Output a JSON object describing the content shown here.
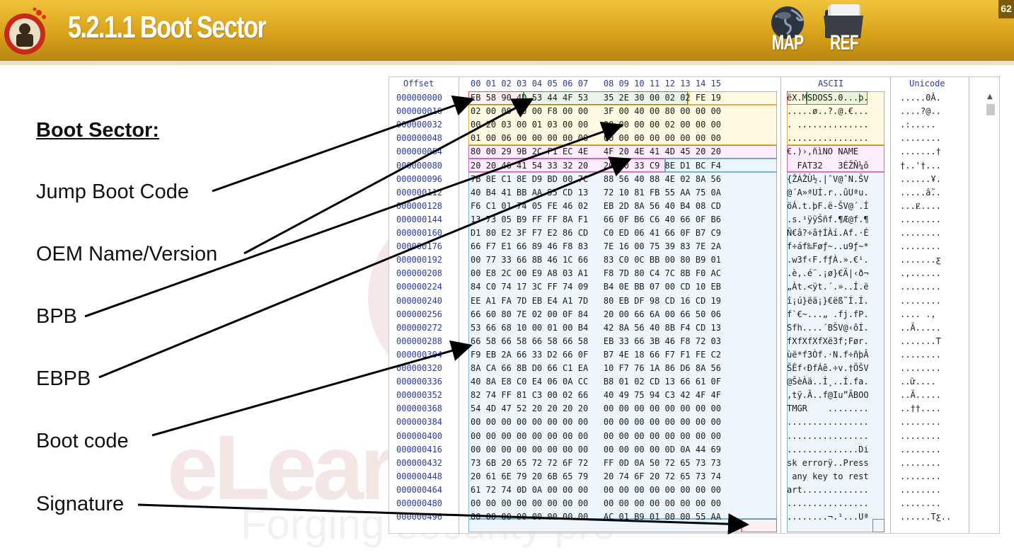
{
  "header": {
    "title": "5.2.1.1 Boot Sector",
    "map_label": "MAP",
    "ref_label": "REF",
    "page_number": "62"
  },
  "watermark": {
    "brand": "eLearn",
    "tagline": "Forging security pro"
  },
  "labels": {
    "section_title": "Boot Sector:",
    "jump": "Jump Boot Code",
    "oem": "OEM Name/Version",
    "bpb": "BPB",
    "ebpb": "EBPB",
    "boot_code": "Boot code",
    "signature": "Signature"
  },
  "hex_view": {
    "col_offset": "Offset",
    "col_hex": "00 01 02 03 04 05 06 07   08 09 10 11 12 13 14 15",
    "col_ascii": "ASCII",
    "col_unicode": "Unicode",
    "rows": [
      {
        "off": "000000000",
        "hex": "EB 58 90 4D 53 44 4F 53   35 2E 30 00 02 02 FE 19",
        "asc": "ëX.MSDOS5.0...þ.",
        "uni": ".....0Â."
      },
      {
        "off": "000000016",
        "hex": "02 00 00 00 00 F8 00 00   3F 00 40 00 80 00 00 00",
        "asc": ".....ø..?.@.€...",
        "uni": "....?@.."
      },
      {
        "off": "000000032",
        "hex": "00 20 03 00 01 03 00 00   00 00 00 00 02 00 00 00",
        "asc": ". ..............",
        "uni": ".:....."
      },
      {
        "off": "000000048",
        "hex": "01 00 06 00 00 00 00 00   00 00 00 00 00 00 00 00",
        "asc": "................",
        "uni": "........"
      },
      {
        "off": "000000064",
        "hex": "80 00 29 9B 2C F1 EC 4E   4F 20 4E 41 4D 45 20 20",
        "asc": "€.)›,ñìNO NAME  ",
        "uni": ".......†"
      },
      {
        "off": "000000080",
        "hex": "20 20 46 41 54 33 32 20   20 20 33 C9 8E D1 BC F4",
        "asc": "  FAT32   3ÉŽÑ¼ô",
        "uni": "†..'†..."
      },
      {
        "off": "000000096",
        "hex": "7B 8E C1 8E D9 BD 00 7C   88 56 40 88 4E 02 8A 56",
        "asc": "{ŽÁŽÙ½.|ˆV@ˆN.ŠV",
        "uni": "......Ұ."
      },
      {
        "off": "000000112",
        "hex": "40 B4 41 BB AA 55 CD 13   72 10 81 FB 55 AA 75 0A",
        "asc": "@´A»ªUÍ.r..ûUªu.",
        "uni": ".....ẫ.."
      },
      {
        "off": "000000128",
        "hex": "F6 C1 01 74 05 FE 46 02   EB 2D 8A 56 40 B4 08 CD",
        "asc": "öÁ.t.þF.ë-ŠV@´.Í",
        "uni": "...Ɇ...."
      },
      {
        "off": "000000144",
        "hex": "13 73 05 B9 FF FF 8A F1   66 0F B6 C6 40 66 0F B6",
        "asc": ".s.¹ÿÿŠñf.¶Æ@f.¶",
        "uni": "........"
      },
      {
        "off": "000000160",
        "hex": "D1 80 E2 3F F7 E2 86 CD   C0 ED 06 41 66 0F B7 C9",
        "asc": "Ñ€â?÷â†ÍÀí.Af.·É",
        "uni": "........"
      },
      {
        "off": "000000176",
        "hex": "66 F7 E1 66 89 46 F8 83   7E 16 00 75 39 83 7E 2A",
        "asc": "f÷áf‰Føƒ~..u9ƒ~*",
        "uni": "........"
      },
      {
        "off": "000000192",
        "hex": "00 77 33 66 8B 46 1C 66   83 C0 0C BB 00 80 B9 01",
        "asc": ".w3f‹F.fƒÀ.».€¹.",
        "uni": ".......ƹ"
      },
      {
        "off": "000000208",
        "hex": "00 E8 2C 00 E9 A8 03 A1   F8 7D 80 C4 7C 8B F0 AC",
        "asc": ".è,.é¨.¡ø}€Ä|‹ð¬",
        "uni": ".,......"
      },
      {
        "off": "000000224",
        "hex": "84 C0 74 17 3C FF 74 09   B4 0E BB 07 00 CD 10 EB",
        "asc": "„Àt.<ÿt.´.»..Í.ë",
        "uni": "........"
      },
      {
        "off": "000000240",
        "hex": "EE A1 FA 7D EB E4 A1 7D   80 EB DF 98 CD 16 CD 19",
        "asc": "î¡ú}ëä¡}€ëß˜Í.Í.",
        "uni": "........"
      },
      {
        "off": "000000256",
        "hex": "66 60 80 7E 02 00 0F 84   20 00 66 6A 00 66 50 06",
        "asc": "f`€~...„ .fj.fP.",
        "uni": ".... .,"
      },
      {
        "off": "000000272",
        "hex": "53 66 68 10 00 01 00 B4   42 8A 56 40 8B F4 CD 13",
        "asc": "Sfh....´BŠV@‹ôÍ.",
        "uni": "..Ã....."
      },
      {
        "off": "000000288",
        "hex": "66 58 66 58 66 58 66 58   EB 33 66 3B 46 F8 72 03",
        "asc": "fXfXfXfXë3f;Før.",
        "uni": ".......T"
      },
      {
        "off": "000000304",
        "hex": "F9 EB 2A 66 33 D2 66 0F   B7 4E 18 66 F7 F1 FE C2",
        "asc": "ùë*f3Òf.·N.f÷ñþÂ",
        "uni": "........"
      },
      {
        "off": "000000320",
        "hex": "8A CA 66 8B D0 66 C1 EA   10 F7 76 1A 86 D6 8A 56",
        "asc": "ŠÊf‹ÐfÁê.÷v.†ÖŠV",
        "uni": "........"
      },
      {
        "off": "000000336",
        "hex": "40 8A E8 C0 E4 06 0A CC   B8 01 02 CD 13 66 61 0F",
        "asc": "@ŠèÀä..Ì¸..Í.fa.",
        "uni": "..ữ...."
      },
      {
        "off": "000000352",
        "hex": "82 74 FF 81 C3 00 02 66   40 49 75 94 C3 42 4F 4F",
        "asc": "‚tÿ.Ã..f@Iu”ÃBOO",
        "uni": "..Ã....."
      },
      {
        "off": "000000368",
        "hex": "54 4D 47 52 20 20 20 20   00 00 00 00 00 00 00 00",
        "asc": "TMGR    ........",
        "uni": "..††...."
      },
      {
        "off": "000000384",
        "hex": "00 00 00 00 00 00 00 00   00 00 00 00 00 00 00 00",
        "asc": "................",
        "uni": "........"
      },
      {
        "off": "000000400",
        "hex": "00 00 00 00 00 00 00 00   00 00 00 00 00 00 00 00",
        "asc": "................",
        "uni": "........"
      },
      {
        "off": "000000416",
        "hex": "00 00 00 00 00 00 00 00   00 00 00 00 0D 0A 44 69",
        "asc": "..............Di",
        "uni": "........"
      },
      {
        "off": "000000432",
        "hex": "73 6B 20 65 72 72 6F 72   FF 0D 0A 50 72 65 73 73",
        "asc": "sk errorÿ..Press",
        "uni": "........"
      },
      {
        "off": "000000448",
        "hex": "20 61 6E 79 20 6B 65 79   20 74 6F 20 72 65 73 74",
        "asc": " any key to rest",
        "uni": "........"
      },
      {
        "off": "000000464",
        "hex": "61 72 74 0D 0A 00 00 00   00 00 00 00 00 00 00 00",
        "asc": "art.............",
        "uni": "........"
      },
      {
        "off": "000000480",
        "hex": "00 00 00 00 00 00 00 00   00 00 00 00 00 00 00 00",
        "asc": "................",
        "uni": "........"
      },
      {
        "off": "000000496",
        "hex": "00 00 00 00 00 00 00 00   AC 01 B9 01 00 00 55 AA",
        "asc": "........¬.¹...Uª",
        "uni": "......Tƹ.."
      }
    ]
  }
}
